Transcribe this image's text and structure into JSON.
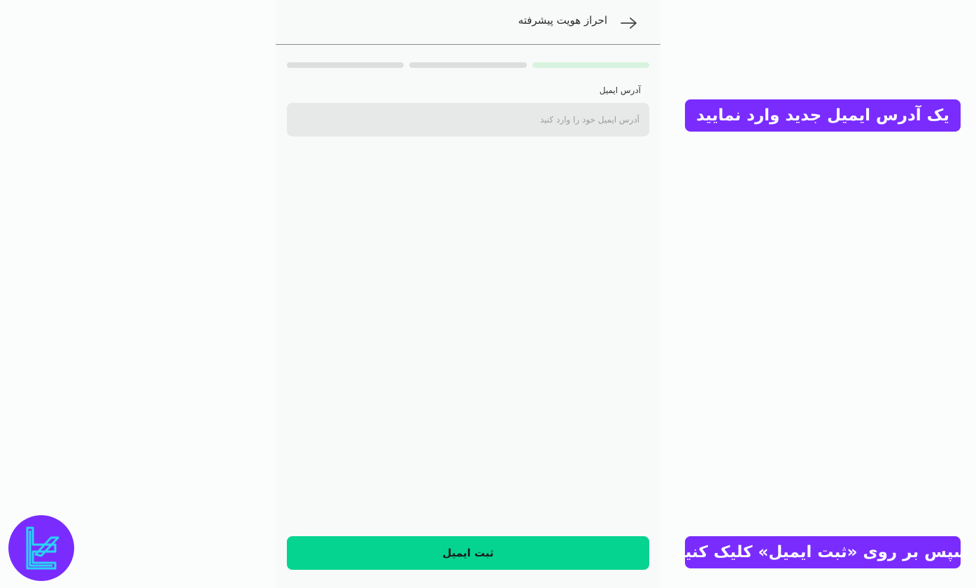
{
  "header": {
    "title": "احراز هویت پیشرفته",
    "back_icon": "arrow-right-icon"
  },
  "progress": {
    "steps": 3,
    "current_step": 1,
    "colors": {
      "active": "#d7f3df",
      "inactive": "#dcdfde"
    }
  },
  "form": {
    "email_label": "آدرس ایمیل",
    "email_value": "",
    "email_placeholder": "آدرس ایمیل خود را وارد کنید",
    "submit_label": "ثبت ایمیل"
  },
  "annotations": {
    "step1": "یک آدرس ایمیل جدید وارد نمایید",
    "step2": "سپس بر روی «ثبت ایمیل» کلیک کنید"
  },
  "colors": {
    "accent": "#7a2cff",
    "submit_button": "#04d48f",
    "logo_stroke": "#29d3f5"
  },
  "logo": {
    "icon": "brand-logo-icon"
  }
}
